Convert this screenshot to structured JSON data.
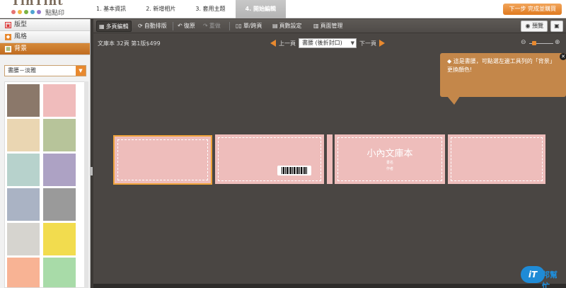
{
  "brand": {
    "name": "TinTint",
    "sub": "點點印"
  },
  "steps": [
    {
      "label": "1. 基本資訊"
    },
    {
      "label": "2. 新增相片"
    },
    {
      "label": "3. 套用主題"
    },
    {
      "label": "4. 開始編輯"
    }
  ],
  "next_button": "下一步  完成並購買",
  "sidebar": {
    "panels": [
      {
        "label": "版型"
      },
      {
        "label": "風格"
      },
      {
        "label": "背景"
      }
    ],
    "theme_select": "書腰－淡雅",
    "swatch_colors": [
      "#8b786a",
      "#f0bcbc",
      "#ead6b2",
      "#b7c49a",
      "#b7d2cc",
      "#ada2c4",
      "#aab3c4",
      "#9a9a9a",
      "#d6d4cf",
      "#f2dc4e",
      "#f8b394",
      "#a8dba8"
    ]
  },
  "toolbar": {
    "items": [
      {
        "label": "多頁編輯"
      },
      {
        "label": "自動排版"
      },
      {
        "label": "復原"
      },
      {
        "label": "重做"
      },
      {
        "label": "單/跨頁"
      },
      {
        "label": "頁數設定"
      },
      {
        "label": "頁面管理"
      }
    ],
    "preview": "預覽"
  },
  "canvas": {
    "book_info": "文庫本 32頁 第1版$499",
    "prev": "上一頁",
    "next": "下一頁",
    "page_select": "書腰 (後折封口)",
    "tip": "◆ 這是書腰，可點選左邊工具列的「背景」更換顏色!",
    "cover_title": "小內文庫本",
    "cover_sub1": "書名",
    "cover_sub2": "作者",
    "page_color": "#eebdbb"
  },
  "watermark": {
    "badge": "iT",
    "text": "邦幫忙"
  }
}
